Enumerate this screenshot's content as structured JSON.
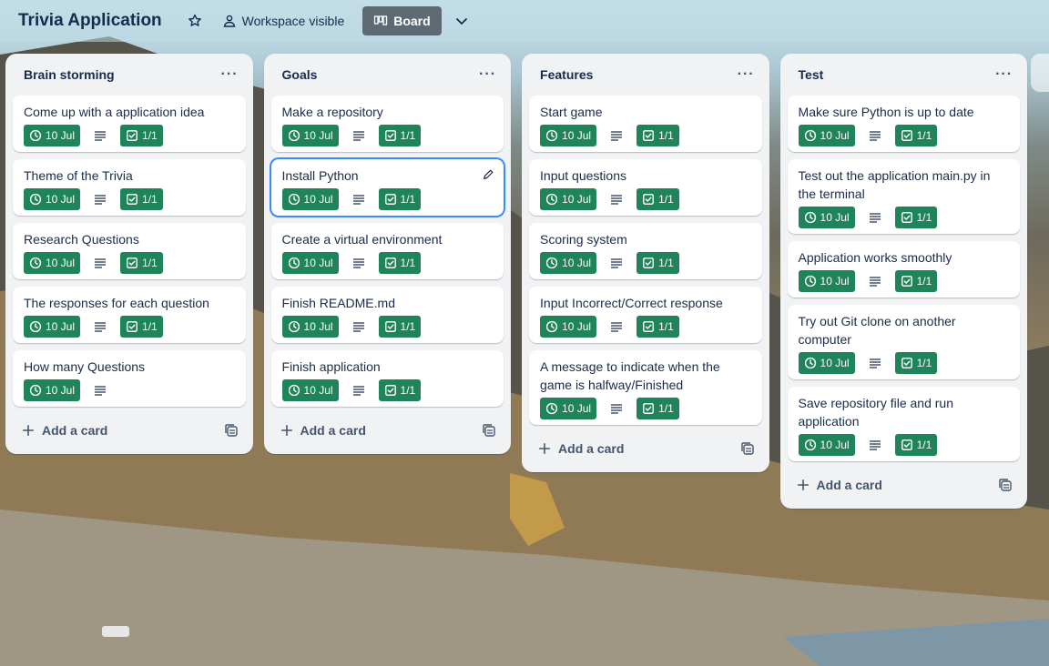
{
  "board": {
    "title": "Trivia Application",
    "star_icon": "star-icon",
    "visibility_label": "Workspace visible",
    "view_label": "Board",
    "chevron_icon": "chevron-down-icon"
  },
  "colors": {
    "badge_green": "#1f845a",
    "list_bg": "#f1f2f4",
    "text": "#172b4d",
    "selected_border": "#388bff"
  },
  "lists": [
    {
      "title": "Brain storming",
      "menu": "···",
      "add_label": "Add a card",
      "cards": [
        {
          "title": "Come up with a application idea",
          "date": "10 Jul",
          "checklist": "1/1"
        },
        {
          "title": "Theme of the Trivia",
          "date": "10 Jul",
          "checklist": "1/1"
        },
        {
          "title": "Research Questions",
          "date": "10 Jul",
          "checklist": "1/1"
        },
        {
          "title": "The responses for each question",
          "date": "10 Jul",
          "checklist": "1/1"
        },
        {
          "title": "How many Questions",
          "date": "10 Jul",
          "checklist": ""
        }
      ]
    },
    {
      "title": "Goals",
      "menu": "···",
      "add_label": "Add a card",
      "cards": [
        {
          "title": "Make a repository",
          "date": "10 Jul",
          "checklist": "1/1"
        },
        {
          "title": "Install Python",
          "date": "10 Jul",
          "checklist": "1/1",
          "selected": true
        },
        {
          "title": "Create a virtual environment",
          "date": "10 Jul",
          "checklist": "1/1"
        },
        {
          "title": "Finish README.md",
          "date": "10 Jul",
          "checklist": "1/1"
        },
        {
          "title": "Finish application",
          "date": "10 Jul",
          "checklist": "1/1"
        }
      ]
    },
    {
      "title": "Features",
      "menu": "···",
      "add_label": "Add a card",
      "cards": [
        {
          "title": "Start game",
          "date": "10 Jul",
          "checklist": "1/1"
        },
        {
          "title": "Input questions",
          "date": "10 Jul",
          "checklist": "1/1"
        },
        {
          "title": "Scoring system",
          "date": "10 Jul",
          "checklist": "1/1"
        },
        {
          "title": "Input Incorrect/Correct response",
          "date": "10 Jul",
          "checklist": "1/1"
        },
        {
          "title": "A message to indicate when the game is halfway/Finished",
          "date": "10 Jul",
          "checklist": "1/1"
        }
      ]
    },
    {
      "title": "Test",
      "menu": "···",
      "add_label": "Add a card",
      "cards": [
        {
          "title": "Make sure Python is up to date",
          "date": "10 Jul",
          "checklist": "1/1"
        },
        {
          "title": "Test out the application main.py in the terminal",
          "date": "10 Jul",
          "checklist": "1/1"
        },
        {
          "title": "Application works smoothly",
          "date": "10 Jul",
          "checklist": "1/1"
        },
        {
          "title": "Try out Git clone on another computer",
          "date": "10 Jul",
          "checklist": "1/1"
        },
        {
          "title": "Save repository file and run application",
          "date": "10 Jul",
          "checklist": "1/1"
        }
      ]
    }
  ]
}
